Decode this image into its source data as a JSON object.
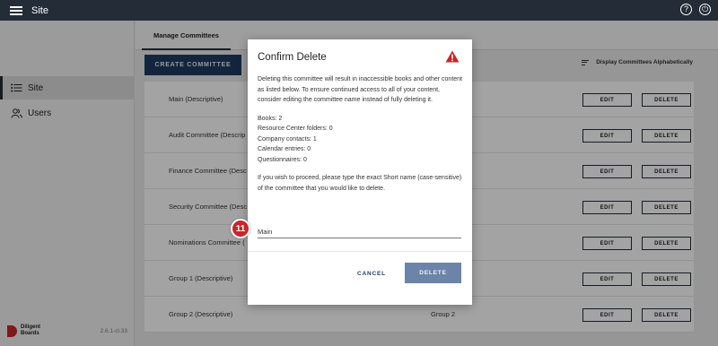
{
  "topbar": {
    "title": "Site",
    "help_icon": "?",
    "power_icon": "⏻"
  },
  "sidebar": {
    "items": [
      {
        "label": "Site",
        "icon": "list-icon"
      },
      {
        "label": "Users",
        "icon": "users-icon"
      }
    ],
    "footer": {
      "brand_line1": "Diligent",
      "brand_line2": "Boards",
      "version": "2.6.1-cl.33"
    }
  },
  "main": {
    "tab_label": "Manage Committees",
    "create_label": "CREATE COMMITTEE",
    "sort_label": "Display Committees Alphabetically",
    "edit_label": "EDIT",
    "delete_label": "DELETE",
    "rows": [
      {
        "name": "Main (Descriptive)",
        "short": ""
      },
      {
        "name": "Audit Committee (Descrip",
        "short": ""
      },
      {
        "name": "Finance Committee (Desc",
        "short": ""
      },
      {
        "name": "Security Committee (Desc",
        "short": ""
      },
      {
        "name": "Nominations Committee (",
        "short": ""
      },
      {
        "name": "Group 1 (Descriptive)",
        "short": ""
      },
      {
        "name": "Group 2 (Descriptive)",
        "short": "Group 2"
      }
    ]
  },
  "modal": {
    "title": "Confirm Delete",
    "warning": "Deleting this committee will result in inaccessible books and other content as listed below. To ensure continued access to all of your content, consider editing the committee name instead of fully deleting it.",
    "stats": [
      "Books: 2",
      "Resource Center folders: 0",
      "Company contacts: 1",
      "Calendar entries: 0",
      "Questionnaires: 0"
    ],
    "instruction": "If you wish to proceed, please type the exact Short name (case-sensitive) of the committee that you would like to delete.",
    "input_value": "Main",
    "cancel_label": "CANCEL",
    "delete_label": "DELETE"
  },
  "badge": {
    "number": "11"
  },
  "colors": {
    "topbar": "#242d37",
    "accent": "#1e3a5f",
    "danger": "#c8252c",
    "delete_button": "#6b84a8"
  }
}
